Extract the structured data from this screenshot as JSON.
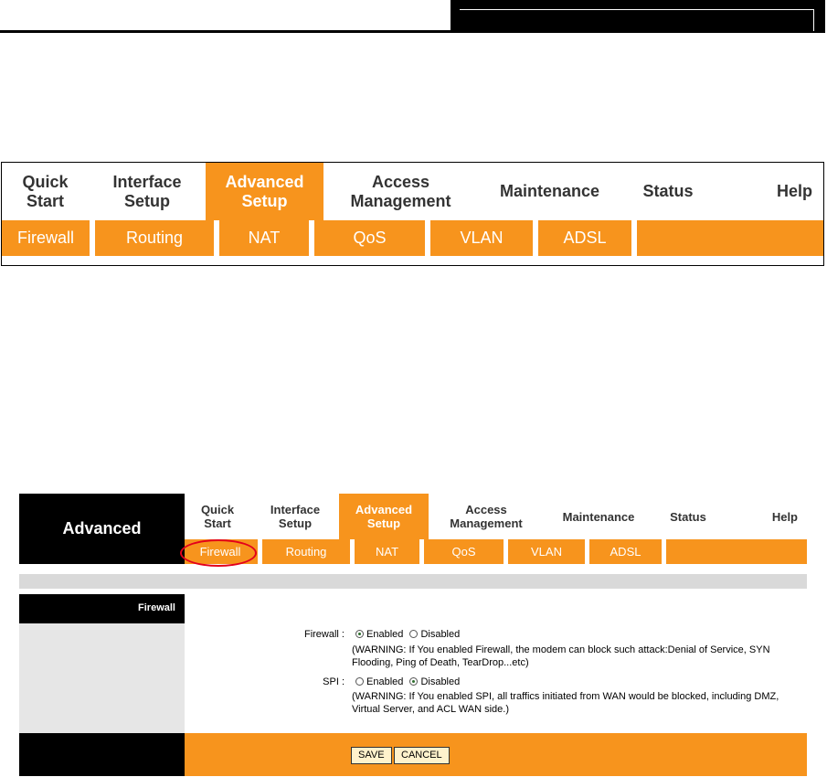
{
  "nav": {
    "top": [
      {
        "label": "Quick\nStart",
        "active": false
      },
      {
        "label": "Interface\nSetup",
        "active": false
      },
      {
        "label": "Advanced\nSetup",
        "active": true
      },
      {
        "label": "Access\nManagement",
        "active": false
      },
      {
        "label": "Maintenance",
        "active": false
      },
      {
        "label": "Status",
        "active": false
      },
      {
        "label": "Help",
        "active": false
      }
    ],
    "sub": [
      "Firewall",
      "Routing",
      "NAT",
      "QoS",
      "VLAN",
      "ADSL"
    ]
  },
  "screen": {
    "brand": "Advanced",
    "section_title": "Firewall",
    "firewall": {
      "label": "Firewall :",
      "enabled_label": "Enabled",
      "disabled_label": "Disabled",
      "selected": "Enabled",
      "warning": "(WARNING: If You enabled Firewall, the modem can block such attack:Denial of Service, SYN Flooding, Ping of Death, TearDrop...etc)"
    },
    "spi": {
      "label": "SPI :",
      "enabled_label": "Enabled",
      "disabled_label": "Disabled",
      "selected": "Disabled",
      "warning": "(WARNING: If You enabled SPI, all traffics initiated from WAN would be blocked, including DMZ, Virtual Server, and ACL WAN side.)"
    },
    "buttons": {
      "save": "SAVE",
      "cancel": "CANCEL"
    }
  },
  "colors": {
    "accent": "#f7941d",
    "header": "#000000",
    "highlight": "#e3001b"
  }
}
